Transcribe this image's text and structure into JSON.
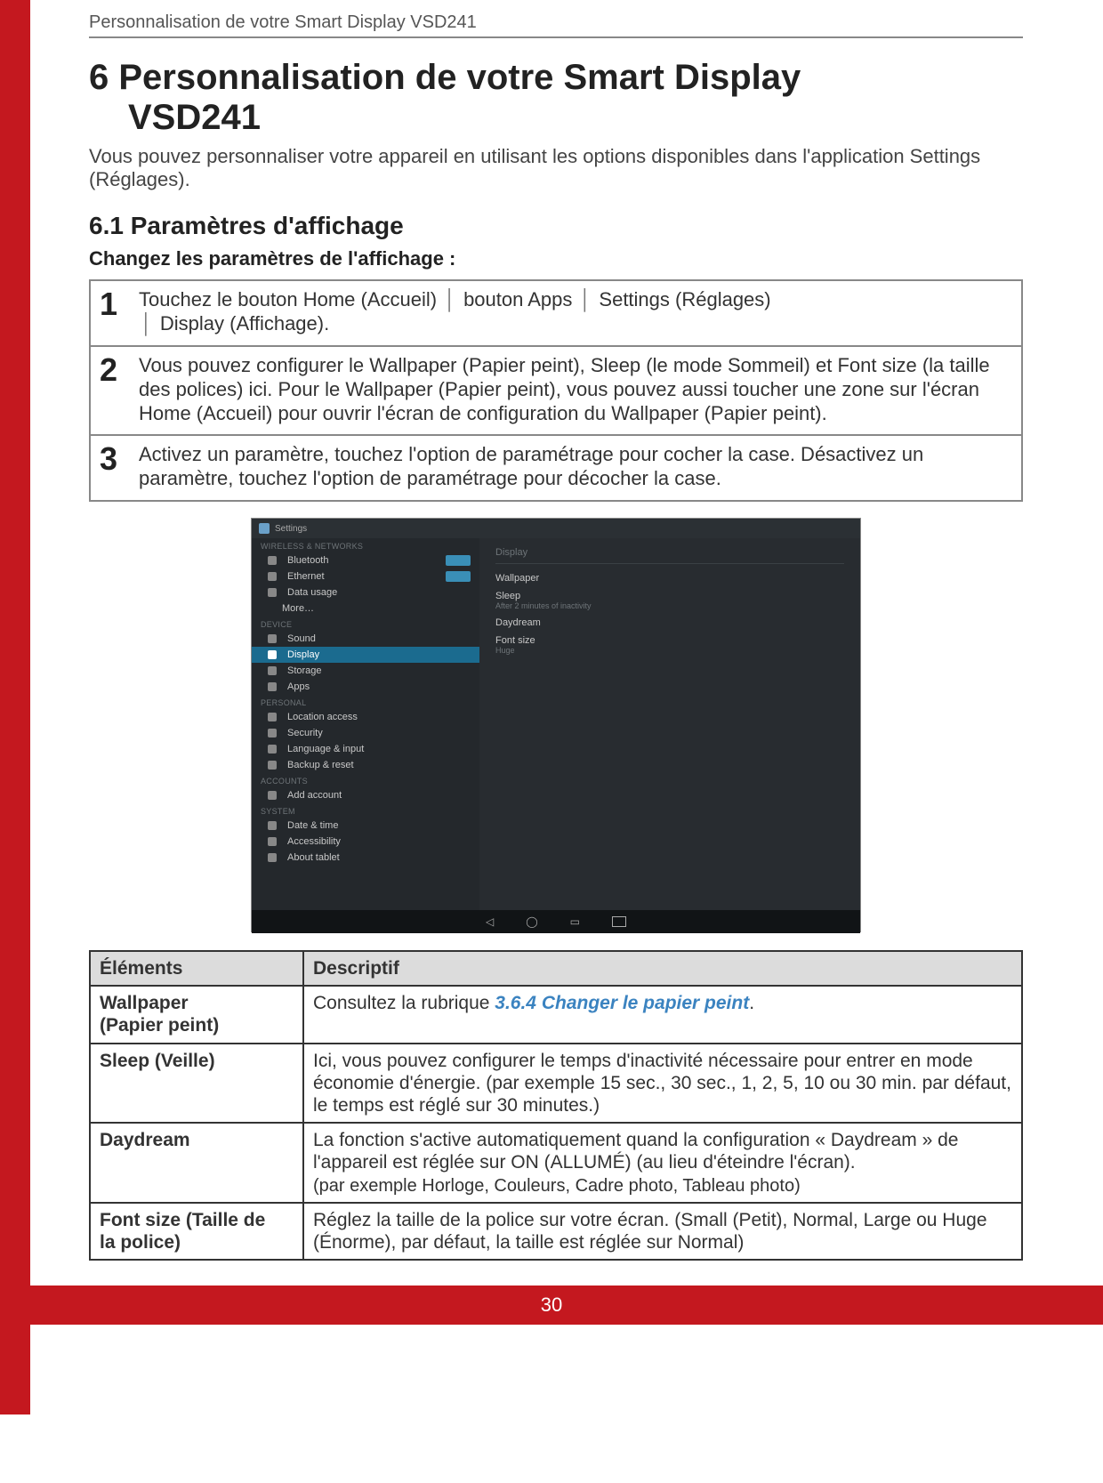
{
  "header": {
    "running_head": "Personnalisation de votre Smart Display VSD241"
  },
  "chapter": {
    "title_line1": "6 Personnalisation de votre Smart Display",
    "title_line2": "VSD241",
    "intro": "Vous pouvez personnaliser votre appareil en utilisant les options disponibles dans l'application Settings (Réglages)."
  },
  "section": {
    "title": "6.1  Paramètres d'affichage",
    "subhead": "Changez les paramètres de l'affichage :"
  },
  "steps": [
    {
      "num": "1",
      "segments": [
        "Touchez le bouton Home (Accueil)",
        "bouton Apps",
        "Settings (Réglages)",
        "Display (Affichage)."
      ]
    },
    {
      "num": "2",
      "text": "Vous pouvez configurer le Wallpaper (Papier peint), Sleep (le mode Sommeil) et Font size (la taille des polices) ici. Pour le Wallpaper (Papier peint), vous pouvez aussi toucher une zone sur l'écran Home (Accueil) pour ouvrir l'écran de configuration du Wallpaper (Papier peint)."
    },
    {
      "num": "3",
      "text": "Activez un paramètre, touchez l'option de paramétrage pour cocher la case. Désactivez un paramètre, touchez l'option de paramétrage pour décocher la case."
    }
  ],
  "screenshot": {
    "title": "Settings",
    "left_categories": {
      "wireless_label": "WIRELESS & NETWORKS",
      "device_label": "DEVICE",
      "personal_label": "PERSONAL",
      "accounts_label": "ACCOUNTS",
      "system_label": "SYSTEM"
    },
    "left_items": {
      "bluetooth": "Bluetooth",
      "ethernet": "Ethernet",
      "data_usage": "Data usage",
      "more": "More…",
      "sound": "Sound",
      "display": "Display",
      "storage": "Storage",
      "apps": "Apps",
      "location": "Location access",
      "security": "Security",
      "lang": "Language & input",
      "backup": "Backup & reset",
      "add_account": "Add account",
      "date_time": "Date & time",
      "accessibility": "Accessibility",
      "about": "About tablet"
    },
    "right_head": "Display",
    "right_items": {
      "wallpaper": "Wallpaper",
      "sleep": "Sleep",
      "sleep_sub": "After 2 minutes of inactivity",
      "daydream": "Daydream",
      "font_size": "Font size",
      "font_size_sub": "Huge"
    }
  },
  "table": {
    "head_col1": "Éléments",
    "head_col2": "Descriptif",
    "rows": [
      {
        "name_line1": "Wallpaper",
        "name_line2": "(Papier peint)",
        "desc_prefix": "Consultez la rubrique ",
        "desc_link": "3.6.4 Changer le papier peint",
        "desc_suffix": "."
      },
      {
        "name": "Sleep (Veille)",
        "desc": "Ici, vous pouvez configurer le temps d'inactivité nécessaire pour entrer en mode économie d'énergie. (par exemple 15 sec., 30 sec., 1, 2, 5, 10 ou 30 min. par défaut, le temps est réglé sur 30 minutes.)"
      },
      {
        "name": "Daydream",
        "desc_line1": "La fonction s'active automatiquement quand la configuration « Daydream » de l'appareil est réglée sur ON (ALLUMÉ) (au lieu d'éteindre l'écran).",
        "desc_line2": "(par exemple Horloge, Couleurs, Cadre photo, Tableau photo)"
      },
      {
        "name_line1": "Font size (Taille de",
        "name_line2": "la police)",
        "desc": "Réglez la taille de la police sur votre écran. (Small (Petit), Normal, Large ou Huge (Énorme), par défaut, la taille est réglée sur Normal)"
      }
    ]
  },
  "footer": {
    "page_number": "30"
  }
}
